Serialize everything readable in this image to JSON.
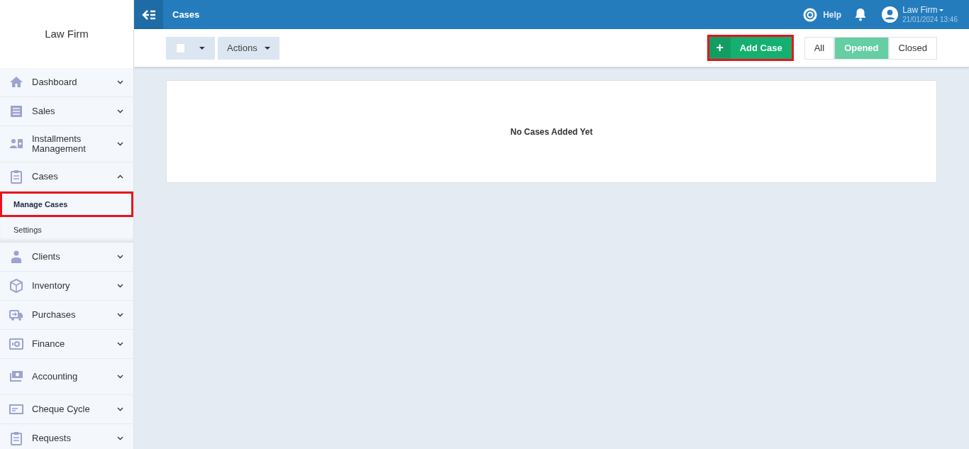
{
  "brand": "Law Firm",
  "sidebar": {
    "items": [
      {
        "label": "Dashboard",
        "kind": "home",
        "expanded": false
      },
      {
        "label": "Sales",
        "kind": "list",
        "expanded": false
      },
      {
        "label": "Installments Management",
        "kind": "person-card",
        "expanded": false
      },
      {
        "label": "Cases",
        "kind": "clipboard",
        "expanded": true,
        "children": [
          {
            "label": "Manage Cases",
            "selected": true,
            "highlighted": true
          },
          {
            "label": "Settings",
            "selected": false,
            "highlighted": false
          }
        ]
      },
      {
        "label": "Clients",
        "kind": "person",
        "expanded": false
      },
      {
        "label": "Inventory",
        "kind": "box",
        "expanded": false
      },
      {
        "label": "Purchases",
        "kind": "truck",
        "expanded": false
      },
      {
        "label": "Finance",
        "kind": "safe",
        "expanded": false
      },
      {
        "label": "Accounting",
        "kind": "money",
        "expanded": false
      },
      {
        "label": "Cheque Cycle",
        "kind": "cheque",
        "expanded": false
      },
      {
        "label": "Requests",
        "kind": "clipboard",
        "expanded": false
      }
    ]
  },
  "topbar": {
    "title": "Cases",
    "help": "Help",
    "user": "Law Firm",
    "datetime": "21/01/2024 13:46"
  },
  "toolbar": {
    "select_all_checked": false,
    "actions": "Actions",
    "add_button": {
      "icon": "+",
      "label": "Add Case",
      "highlighted": true
    },
    "filters": [
      {
        "label": "All",
        "selected": false
      },
      {
        "label": "Opened",
        "selected": true
      },
      {
        "label": "Closed",
        "selected": false
      }
    ]
  },
  "empty_message": "No Cases Added Yet"
}
